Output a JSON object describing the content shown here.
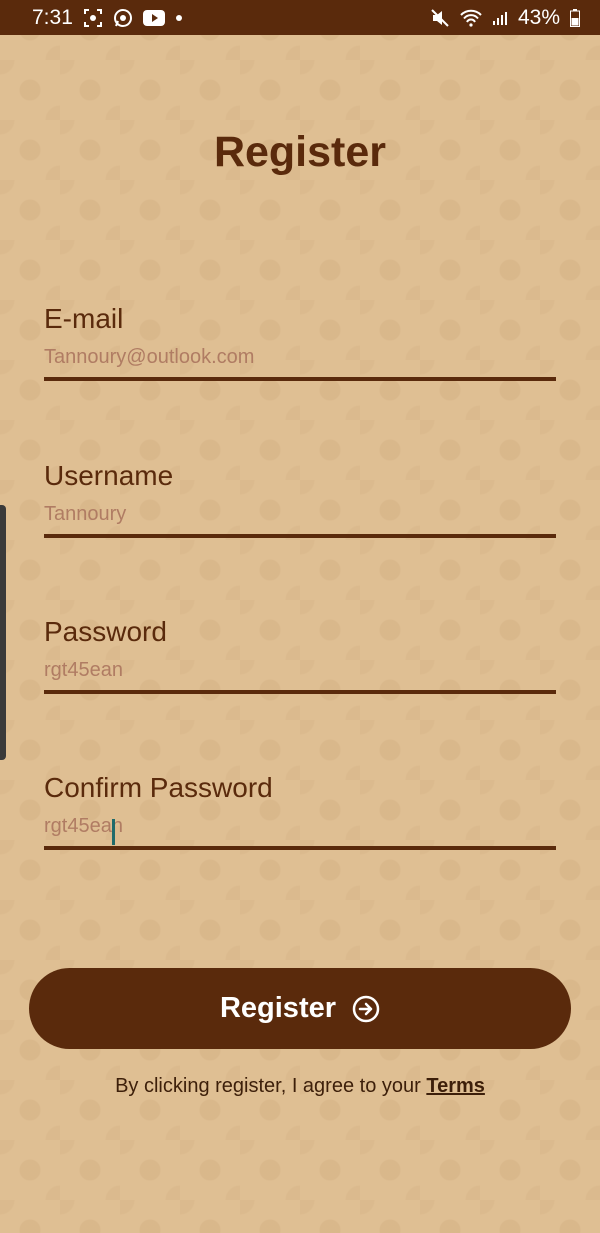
{
  "status_bar": {
    "time": "7:31",
    "battery": "43%"
  },
  "title": "Register",
  "fields": {
    "email": {
      "label": "E-mail",
      "value": "Tannoury@outlook.com"
    },
    "username": {
      "label": "Username",
      "value": "Tannoury"
    },
    "password": {
      "label": "Password",
      "value": "rgt45ean"
    },
    "confirm_password": {
      "label": "Confirm Password",
      "value": "rgt45ean"
    }
  },
  "register_button": {
    "label": "Register",
    "icon": "arrow-circle-right-icon"
  },
  "terms": {
    "text": "By clicking register, I agree to your ",
    "link": "Terms"
  },
  "colors": {
    "primary": "#5a2a0c",
    "background": "#dfbf93",
    "input_text": "#b07c63"
  }
}
